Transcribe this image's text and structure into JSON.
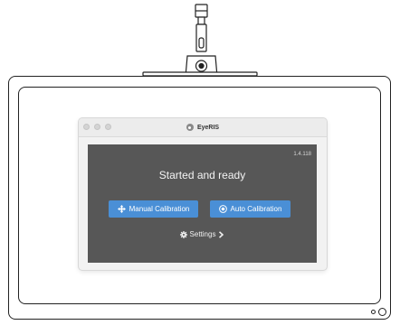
{
  "window": {
    "title": "EyeRIS",
    "version": "1.4.118"
  },
  "main": {
    "status": "Started and ready",
    "manual_calibration_label": "Manual Calibration",
    "auto_calibration_label": "Auto Calibration",
    "settings_label": "Settings"
  },
  "icons": {
    "manual_calibration": "crosshair-move-icon",
    "auto_calibration": "target-icon",
    "settings": "gear-icon",
    "settings_chevron": "chevron-right-icon",
    "app_logo": "eyeris-logo-icon"
  },
  "colors": {
    "primary_button": "#4a8fd6",
    "panel_background": "#575757"
  }
}
